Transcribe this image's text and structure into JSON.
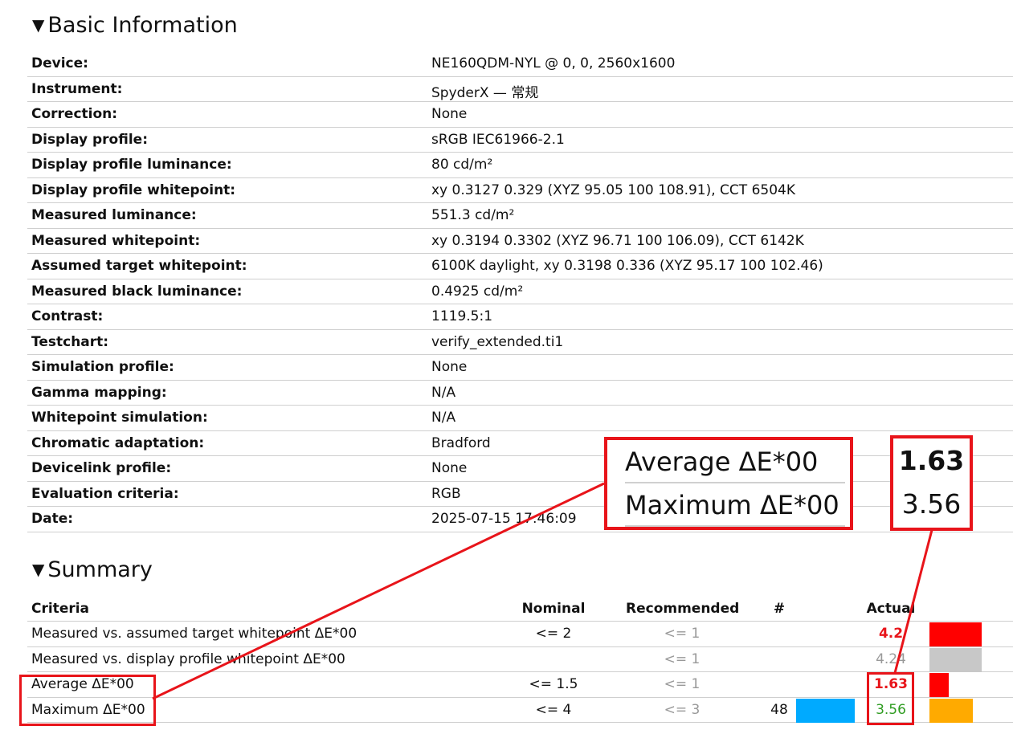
{
  "basic_info": {
    "title": "Basic Information",
    "rows": [
      {
        "label": "Device:",
        "value": "NE160QDM-NYL @ 0, 0, 2560x1600"
      },
      {
        "label": "Instrument:",
        "value": "SpyderX — 常规"
      },
      {
        "label": "Correction:",
        "value": "None"
      },
      {
        "label": "Display profile:",
        "value": "sRGB IEC61966-2.1"
      },
      {
        "label": "Display profile luminance:",
        "value": "80 cd/m²"
      },
      {
        "label": "Display profile whitepoint:",
        "value": "xy 0.3127 0.329 (XYZ 95.05 100 108.91), CCT 6504K"
      },
      {
        "label": "Measured luminance:",
        "value": "551.3 cd/m²"
      },
      {
        "label": "Measured whitepoint:",
        "value": "xy 0.3194 0.3302 (XYZ 96.71 100 106.09), CCT 6142K"
      },
      {
        "label": "Assumed target whitepoint:",
        "value": "6100K daylight, xy 0.3198 0.336 (XYZ 95.17 100 102.46)"
      },
      {
        "label": "Measured black luminance:",
        "value": "0.4925 cd/m²"
      },
      {
        "label": "Contrast:",
        "value": "1119.5:1"
      },
      {
        "label": "Testchart:",
        "value": "verify_extended.ti1"
      },
      {
        "label": "Simulation profile:",
        "value": "None"
      },
      {
        "label": "Gamma mapping:",
        "value": "N/A"
      },
      {
        "label": "Whitepoint simulation:",
        "value": "N/A"
      },
      {
        "label": "Chromatic adaptation:",
        "value": "Bradford"
      },
      {
        "label": "Devicelink profile:",
        "value": "None"
      },
      {
        "label": "Evaluation criteria:",
        "value": "RGB"
      },
      {
        "label": "Date:",
        "value": "2025-07-15 17:46:09"
      }
    ]
  },
  "summary": {
    "title": "Summary",
    "headers": {
      "criteria": "Criteria",
      "nominal": "Nominal",
      "recommended": "Recommended",
      "count": "#",
      "actual": "Actual"
    },
    "rows": [
      {
        "criteria": "Measured vs. assumed target whitepoint ΔE*00",
        "nominal": "<= 2",
        "recommended": "<= 1",
        "count": "",
        "actual": "4.2",
        "status": "fail",
        "bar_color": "#ff0000",
        "bar_level": 0.95
      },
      {
        "criteria": "Measured vs. display profile whitepoint ΔE*00",
        "nominal": "",
        "recommended": "<= 1",
        "count": "",
        "actual": "4.24",
        "status": "info",
        "bar_color": "#c8c8c8",
        "bar_level": 0.95
      },
      {
        "criteria": "Average ΔE*00",
        "nominal": "<= 1.5",
        "recommended": "<= 1",
        "count": "",
        "actual": "1.63",
        "status": "fail",
        "bar_color": "#ff0000",
        "bar_level": 0.36
      },
      {
        "criteria": "Maximum ΔE*00",
        "nominal": "<= 4",
        "recommended": "<= 3",
        "count": "48",
        "actual": "3.56",
        "status": "pass",
        "bar_color": "#ffaa00",
        "bar_level": 0.8,
        "dist_color": "#00aaff"
      }
    ]
  },
  "callout": {
    "labels": [
      "Average ΔE*00",
      "Maximum ΔE*00"
    ],
    "values": [
      "1.63",
      "3.56"
    ]
  },
  "colors": {
    "fail": "#e8141a",
    "pass": "#2f9c21",
    "accent": "#e8141a"
  }
}
